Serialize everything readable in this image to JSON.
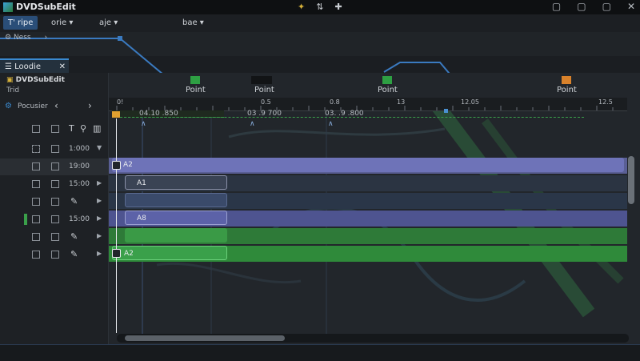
{
  "window": {
    "title": "DVDSubEdit"
  },
  "menubar": {
    "tabs": [
      {
        "label": "T' ripe",
        "active": true
      },
      {
        "label": "orie ▾",
        "active": false
      },
      {
        "label": "aje ▾",
        "active": false
      },
      {
        "label": "bae ▾",
        "active": false
      }
    ]
  },
  "upper": {
    "nav_label": "Ness"
  },
  "panel": {
    "tab_label": "Loodie",
    "project_name": "DVDSubEdit",
    "project_sub": "Trid",
    "nav_label": "Pocusier"
  },
  "markers": [
    {
      "label": "Point",
      "color": "#2ea043"
    },
    {
      "label": "Point",
      "color": "#1a1c1f"
    },
    {
      "label": "Point",
      "color": "#2ea043"
    },
    {
      "label": "Point",
      "color": "#d9822b"
    }
  ],
  "ruler": {
    "labels": [
      "0!",
      "0.5",
      "0.8",
      "13",
      "12.05",
      "12.5"
    ],
    "timecodes": [
      "04.10 .850",
      "03 .9 700",
      "03. .9 .800"
    ]
  },
  "tracks": [
    {
      "time": "",
      "clip": ""
    },
    {
      "time": "1:000",
      "clip": ""
    },
    {
      "time": "19:00",
      "clip": "A2"
    },
    {
      "time": "15:00",
      "clip": "A1"
    },
    {
      "time": "15:00",
      "clip": "A8"
    },
    {
      "time": "",
      "clip": ""
    },
    {
      "time": "",
      "clip": "A2"
    }
  ],
  "colors": {
    "accent": "#3a8ad0",
    "clip_purple": "#6e73b8",
    "clip_green": "#3aa04a",
    "clip_dark": "#2b3442"
  }
}
